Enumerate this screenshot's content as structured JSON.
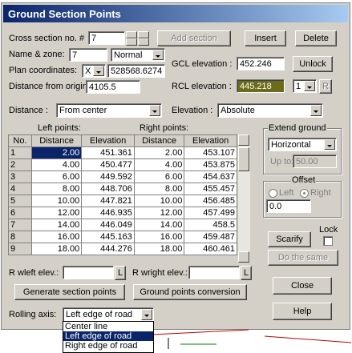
{
  "window": {
    "title": "Ground Section Points",
    "minimize": "_",
    "maximize": "□",
    "close": "×"
  },
  "cross_section": {
    "label": "Cross section no. #",
    "value": "7"
  },
  "name_zone": {
    "label": "Name & zone:",
    "value": "7",
    "zone": "Normal"
  },
  "plan_coords": {
    "label": "Plan coordinates:",
    "axis": "X",
    "value": "528568.6274"
  },
  "distance_origin": {
    "label": "Distance from origin :",
    "value": "4105.5"
  },
  "buttons": {
    "add_section": "Add section",
    "insert": "Insert",
    "delete": "Delete",
    "unlock": "Unlock",
    "r": "R",
    "scarify": "Scarify",
    "do_same": "Do the same",
    "close": "Close",
    "help": "Help",
    "generate": "Generate section points",
    "conversion": "Ground points conversion",
    "l": "L"
  },
  "gcl": {
    "label": "GCL elevation :",
    "value": "452.246"
  },
  "rcl": {
    "label": "RCL elevation :",
    "value": "445.218",
    "color": "#6b6b1a",
    "index": "1"
  },
  "distance": {
    "label": "Distance :",
    "value": "From center"
  },
  "elevation": {
    "label": "Elevation :",
    "value": "Absolute"
  },
  "table": {
    "left_title": "Left points:",
    "right_title": "Right points:",
    "headers": [
      "No.",
      "Distance",
      "Elevation",
      "Distance",
      "Elevation"
    ],
    "rows": [
      [
        "1",
        "2.00",
        "451.361",
        "2.00",
        "453.107"
      ],
      [
        "2",
        "4.00",
        "450.477",
        "4.00",
        "453.875"
      ],
      [
        "3",
        "6.00",
        "449.592",
        "6.00",
        "454.637"
      ],
      [
        "4",
        "8.00",
        "448.706",
        "8.00",
        "455.457"
      ],
      [
        "5",
        "10.00",
        "447.821",
        "10.00",
        "456.485"
      ],
      [
        "6",
        "12.00",
        "446.935",
        "12.00",
        "457.499"
      ],
      [
        "7",
        "14.00",
        "446.049",
        "14.00",
        "458.5"
      ],
      [
        "8",
        "16.00",
        "445.163",
        "16.00",
        "459.487"
      ],
      [
        "9",
        "18.00",
        "444.276",
        "18.00",
        "460.461"
      ]
    ]
  },
  "extend": {
    "title": "Extend ground",
    "mode": "Horizontal",
    "upto_label": "Up to:",
    "upto_value": "50.00"
  },
  "offset": {
    "title": "Offset",
    "left": "Left",
    "right": "Right",
    "value": "0.0"
  },
  "lock": {
    "label": "Lock"
  },
  "wleft": {
    "label": "R wleft elev.:"
  },
  "wright": {
    "label": "R wright elev.:"
  },
  "rolling": {
    "label": "Rolling axis:",
    "value": "Left edge of road",
    "options": [
      "Center line",
      "Left edge of road",
      "Right edge of road"
    ]
  }
}
